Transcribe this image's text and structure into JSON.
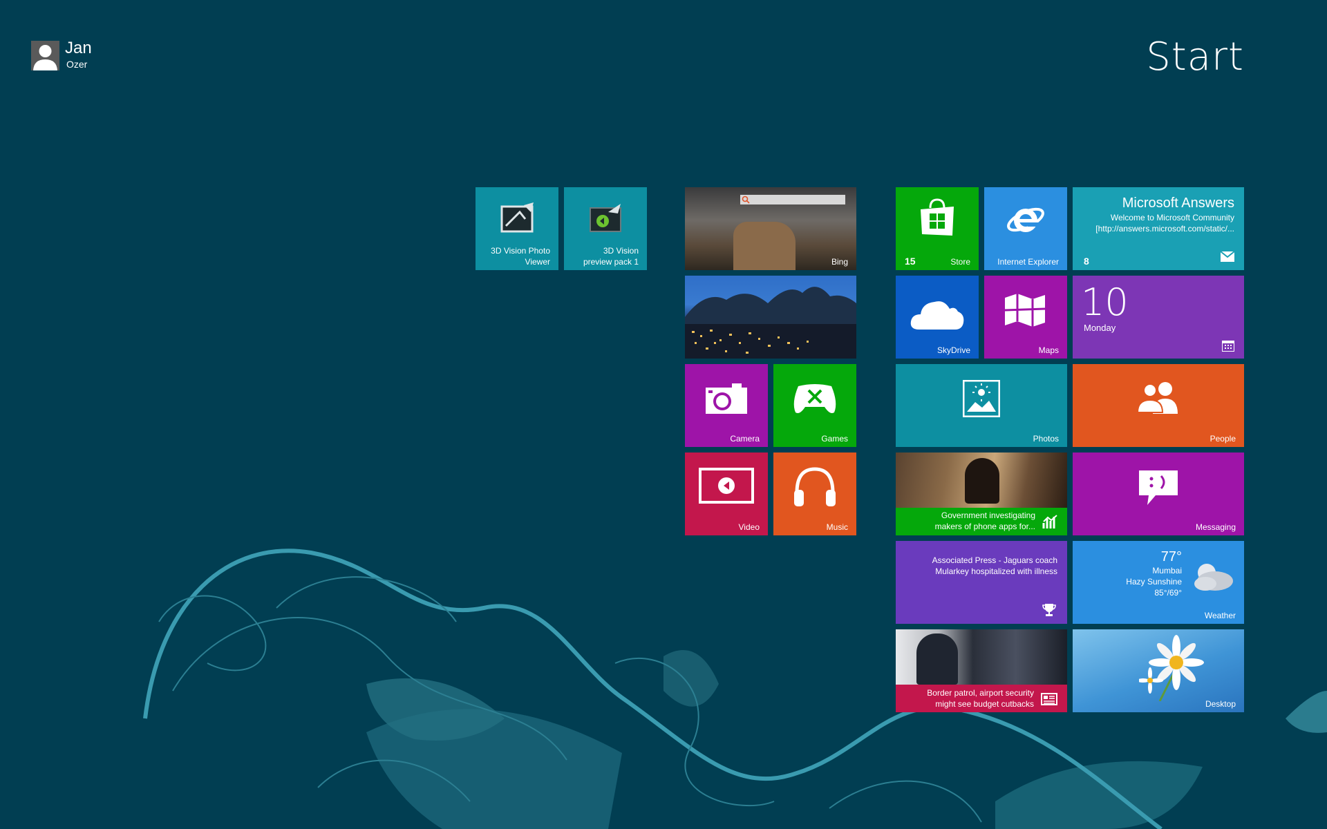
{
  "header": {
    "title": "Start"
  },
  "user": {
    "first_name": "Jan",
    "last_name": "Ozer"
  },
  "tiles": {
    "microsoft_answers": {
      "title": "Microsoft Answers",
      "line1": "Welcome to Microsoft Community",
      "line2": "[http://answers.microsoft.com/static/...",
      "badge": "8"
    },
    "internet_explorer": {
      "label": "Internet Explorer"
    },
    "store": {
      "label": "Store",
      "badge": "15"
    },
    "calendar": {
      "day_number": "10",
      "day_name": "Monday"
    },
    "maps": {
      "label": "Maps"
    },
    "skydrive": {
      "label": "SkyDrive"
    },
    "people": {
      "label": "People"
    },
    "photos": {
      "label": "Photos"
    },
    "messaging": {
      "label": "Messaging"
    },
    "finance_news": {
      "line1": "Government investigating",
      "line2": "makers of phone apps for..."
    },
    "weather": {
      "label": "Weather",
      "temperature": "77°",
      "city": "Mumbai",
      "condition": "Hazy Sunshine",
      "range": "85°/69°"
    },
    "sports": {
      "line1": "Associated Press - Jaguars coach",
      "line2": "Mularkey hospitalized with illness"
    },
    "desktop": {
      "label": "Desktop"
    },
    "news": {
      "line1": "Border patrol, airport security",
      "line2": "might see budget cutbacks"
    },
    "bing": {
      "label": "Bing"
    },
    "travel": {
      "label": ""
    },
    "games": {
      "label": "Games"
    },
    "camera": {
      "label": "Camera"
    },
    "music": {
      "label": "Music"
    },
    "video": {
      "label": "Video"
    },
    "vision_preview": {
      "line1": "3D Vision",
      "line2": "preview pack 1"
    },
    "vision_viewer": {
      "line1": "3D Vision Photo",
      "line2": "Viewer"
    }
  },
  "colors": {
    "background": "#013e52",
    "teal": "#0d8fa1",
    "blue": "#2b8fe0",
    "green": "#05a80b",
    "purple": "#6a3bbd",
    "orange": "#e1561f",
    "magenta": "#9e14a8",
    "crimson": "#c3174c"
  }
}
